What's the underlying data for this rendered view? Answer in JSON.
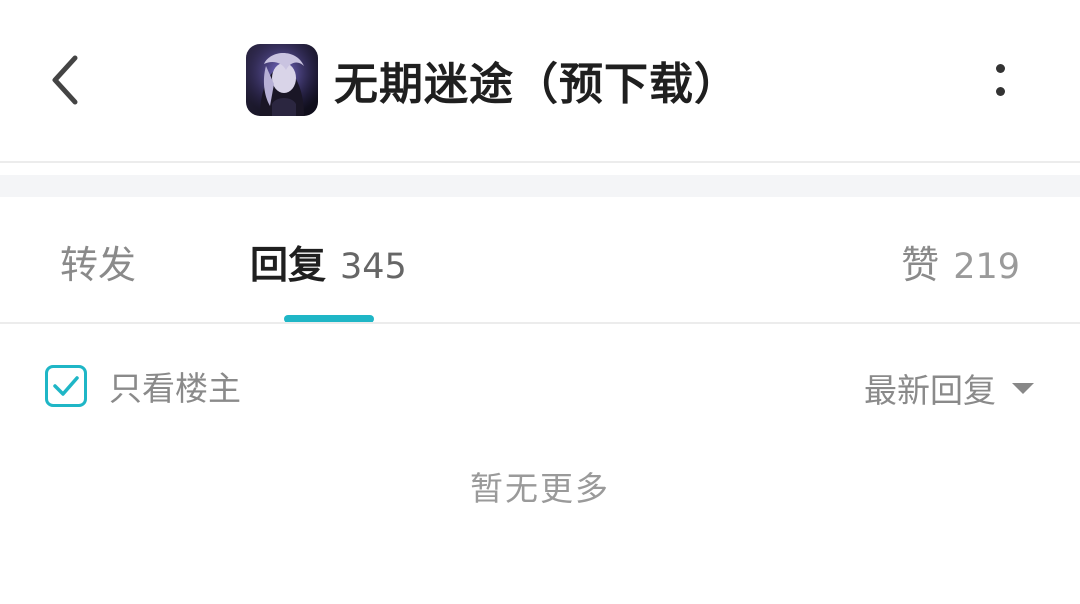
{
  "header": {
    "title": "无期迷途（预下载）",
    "app_icon": "game-avatar-icon",
    "back_icon": "chevron-left-icon",
    "more_icon": "more-vertical-icon"
  },
  "tabs": [
    {
      "label": "转发",
      "count": ""
    },
    {
      "label": "回复",
      "count": "345",
      "active": true
    },
    {
      "label": "赞",
      "count": "219"
    }
  ],
  "filter": {
    "only_owner_label": "只看楼主",
    "only_owner_checked": true,
    "sort_label": "最新回复"
  },
  "empty_text": "暂无更多",
  "colors": {
    "accent": "#1fb6c6",
    "text_primary": "#1f1f1f",
    "text_secondary": "#8a8a8a",
    "divider": "#ececec",
    "band": "#f4f5f7"
  }
}
